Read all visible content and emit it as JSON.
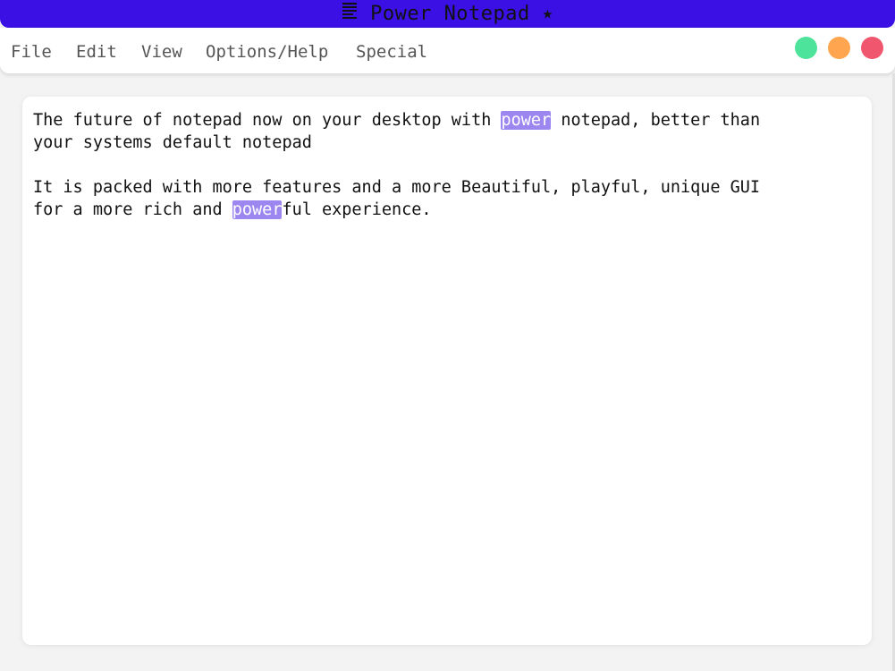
{
  "window": {
    "title": "Power Notepad ⭑",
    "title_icon": "document-lines-icon",
    "titlebar_color": "#3a10e5"
  },
  "menu": {
    "items": [
      {
        "label": "File"
      },
      {
        "label": "Edit"
      },
      {
        "label": "View"
      },
      {
        "label": "Options/Help"
      },
      {
        "label": "Special"
      }
    ]
  },
  "window_controls": {
    "green": "#4de39a",
    "orange": "#ffa54f",
    "red": "#f0566d"
  },
  "editor": {
    "highlight_color": "#9c87f0",
    "line1_a": "The future of notepad now on your desktop with ",
    "line1_hl": "power",
    "line1_b": " notepad, better than",
    "line2": "your systems default notepad",
    "line3": "",
    "line4": "It is packed with more features and a more Beautiful, playful, unique GUI",
    "line5_a": "for a more rich and ",
    "line5_hl": "power",
    "line5_b": "ful experience."
  }
}
